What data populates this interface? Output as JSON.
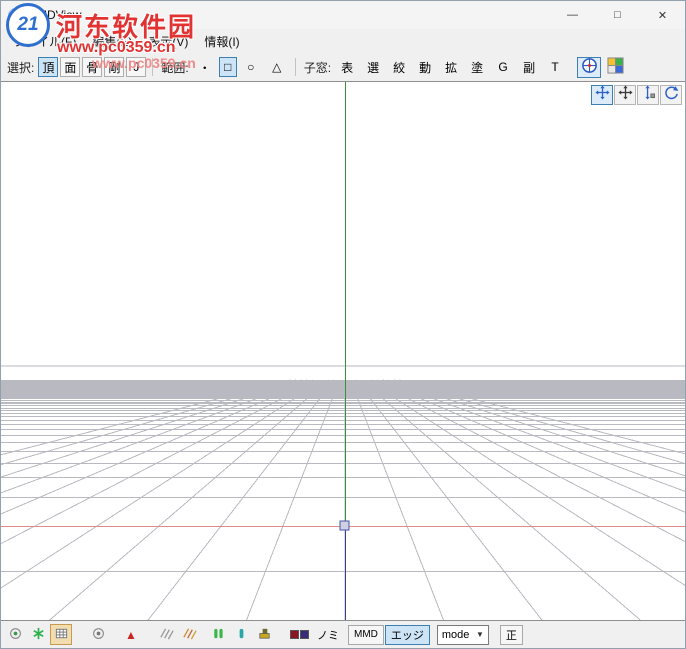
{
  "window": {
    "title": "PMDView"
  },
  "titlebar": {
    "minimize_glyph": "—",
    "maximize_glyph": "□",
    "close_glyph": "✕"
  },
  "menu": {
    "items": [
      {
        "label": "ファイル(F)"
      },
      {
        "label": "編集(E)"
      },
      {
        "label": "表示(V)"
      },
      {
        "label": "情報(I)"
      }
    ]
  },
  "toolbar": {
    "select_label": "選択:",
    "select_buttons": [
      {
        "label": "頂",
        "selected": true
      },
      {
        "label": "面",
        "selected": false
      },
      {
        "label": "骨",
        "selected": false
      },
      {
        "label": "剛",
        "selected": false
      },
      {
        "label": "J",
        "selected": false
      }
    ],
    "range_label": "範囲:",
    "range_buttons": [
      {
        "label": "・",
        "selected": false
      },
      {
        "label": "□",
        "selected": true
      },
      {
        "label": "○",
        "selected": false
      },
      {
        "label": "△",
        "selected": false
      }
    ],
    "subwindow_label": "子窓:",
    "subwindow_buttons": [
      {
        "label": "表"
      },
      {
        "label": "選"
      },
      {
        "label": "絞"
      },
      {
        "label": "動"
      },
      {
        "label": "拡"
      },
      {
        "label": "塗"
      },
      {
        "label": "G"
      },
      {
        "label": "副"
      },
      {
        "label": "T"
      }
    ]
  },
  "viewport": {
    "bg_color": "#ffffff",
    "grid_color": "#b9b9c1",
    "axis_x_color": "#e08b8b",
    "axis_y_color": "#3d8b3d",
    "axis_z_color": "#3a3f8c"
  },
  "bottombar": {
    "nomi_label": "ノミ",
    "mmd_label": "MMD",
    "edge_label": "エッジ",
    "mode_label": "mode",
    "front_label": "正"
  },
  "watermark": {
    "logo_text": "21",
    "site_name": "河东软件园",
    "site_url": "www.pc0359.cn"
  }
}
